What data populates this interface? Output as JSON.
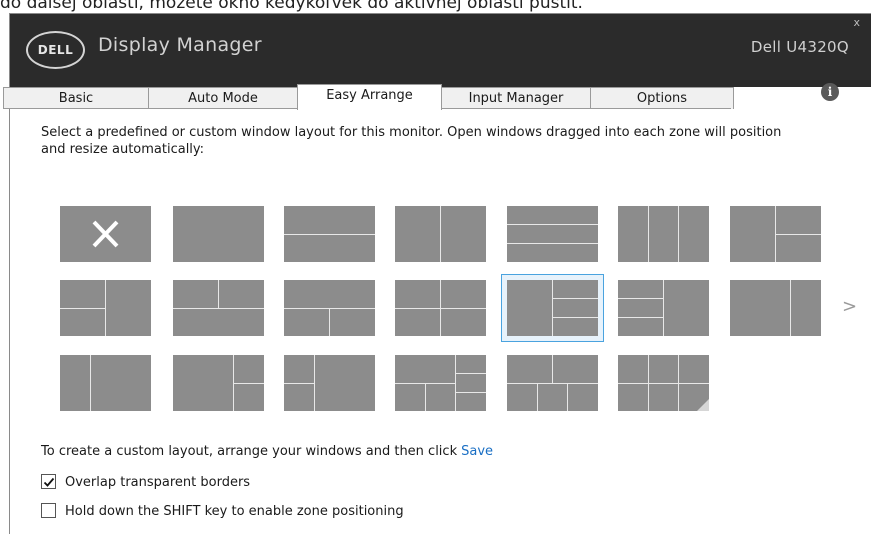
{
  "top_caption": "do ďalšej oblasti, môžete okno kedykoľvek do aktívnej oblasti pustiť.",
  "window": {
    "logo": "DELL",
    "title": "Display Manager",
    "monitor": "Dell U4320Q",
    "close": "x"
  },
  "tabs": [
    {
      "label": "Basic",
      "active": false
    },
    {
      "label": "Auto Mode",
      "active": false
    },
    {
      "label": "Easy Arrange",
      "active": true
    },
    {
      "label": "Input Manager",
      "active": false
    },
    {
      "label": "Options",
      "active": false
    }
  ],
  "info_icon": "i",
  "intro": "Select a predefined or custom window layout for this monitor.  Open windows dragged into each zone will position and resize automatically:",
  "next_arrow": ">",
  "custom_prompt": "To create a custom layout, arrange your windows and then click",
  "save_label": "Save",
  "options": [
    {
      "label": "Overlap transparent borders",
      "checked": true
    },
    {
      "label": "Hold down the SHIFT key to enable zone positioning",
      "checked": false
    }
  ],
  "layouts": {
    "selected": 11,
    "count": 20
  },
  "colors": {
    "title_bar": "#2b2b2b",
    "tile": "#8c8c8c",
    "selection": "#4aa3df",
    "link": "#1a6fc4"
  }
}
